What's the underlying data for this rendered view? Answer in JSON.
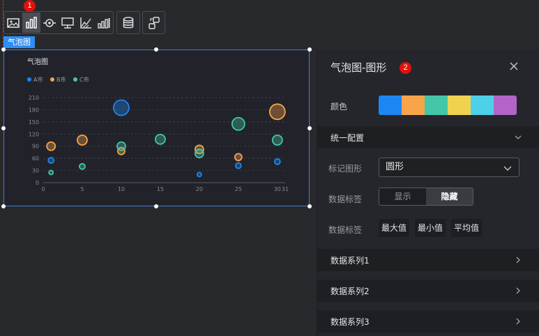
{
  "toolbar": {
    "marker_1": "1",
    "group1_icons": [
      "image-icon",
      "bar-chart-icon",
      "target-icon",
      "text-box-icon",
      "axis-line-icon",
      "data-bar-icon"
    ],
    "db_icon": "database-icon",
    "link_icon": "link-icon"
  },
  "component_tag": "气泡图",
  "chart_data": {
    "type": "scatter",
    "title": "气泡图",
    "xlabel": "",
    "ylabel": "",
    "xlim": [
      0,
      31
    ],
    "ylim": [
      0,
      210
    ],
    "x_ticks": [
      "0",
      "5",
      "10",
      "15",
      "20",
      "25",
      "30",
      "31"
    ],
    "y_ticks": [
      "0",
      "30",
      "60",
      "90",
      "120",
      "150",
      "180",
      "210"
    ],
    "grid": true,
    "legend_position": "top-left",
    "series": [
      {
        "name": "A市",
        "color": "#1d86f0",
        "points": [
          [
            1,
            55,
            4
          ],
          [
            10,
            185,
            11
          ],
          [
            20,
            20,
            3
          ],
          [
            25,
            42,
            4
          ],
          [
            30,
            52,
            4
          ]
        ]
      },
      {
        "name": "B市",
        "color": "#f8a44b",
        "points": [
          [
            1,
            90,
            6
          ],
          [
            5,
            105,
            7
          ],
          [
            10,
            78,
            5
          ],
          [
            20,
            82,
            6
          ],
          [
            25,
            63,
            5
          ],
          [
            30,
            175,
            11
          ]
        ]
      },
      {
        "name": "C市",
        "color": "#43c7a8",
        "points": [
          [
            1,
            25,
            3
          ],
          [
            5,
            40,
            4
          ],
          [
            10,
            90,
            6
          ],
          [
            15,
            107,
            7
          ],
          [
            20,
            72,
            6
          ],
          [
            25,
            145,
            9
          ],
          [
            30,
            105,
            7
          ]
        ]
      }
    ]
  },
  "panel": {
    "marker_2": "2",
    "title": "气泡图-图形",
    "color_label": "颜色",
    "palette": [
      "#1d86f0",
      "#f8a44b",
      "#43c7a8",
      "#efd34f",
      "#4dd0e8",
      "#b264c8"
    ],
    "section_unified": "统一配置",
    "marker_shape_label": "标记图形",
    "marker_shape_value": "圆形",
    "data_label_label": "数据标签",
    "toggle_show": "显示",
    "toggle_hide": "隐藏",
    "data_label2_label": "数据标签",
    "stat_max": "最大值",
    "stat_min": "最小值",
    "stat_avg": "平均值",
    "series_1": "数据系列1",
    "series_2": "数据系列2",
    "series_3": "数据系列3"
  }
}
